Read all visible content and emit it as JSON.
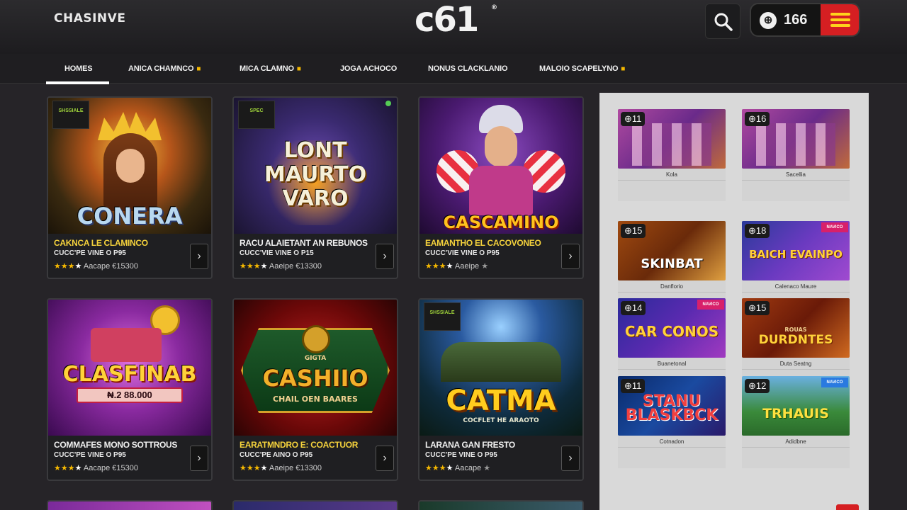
{
  "header": {
    "brand": "CHASINVE",
    "logo": "c61",
    "logo_mark": "®",
    "search_icon": "search-icon",
    "balance": "166",
    "coin_icon": "coin-icon",
    "menu_icon": "hamburger-menu-icon"
  },
  "nav": {
    "items": [
      {
        "label": "HOMES",
        "active": true,
        "badge": false
      },
      {
        "label": "ANICA CHAMNCO",
        "active": false,
        "badge": true
      },
      {
        "label": "MICA CLAMNO",
        "active": false,
        "badge": true
      },
      {
        "label": "JOGA ACHOCO",
        "active": false,
        "badge": false
      },
      {
        "label": "NONUS CLACKLANIO",
        "active": false,
        "badge": false
      },
      {
        "label": "MALOIO SCAPELYNO",
        "active": false,
        "badge": true
      }
    ]
  },
  "cards": [
    {
      "art_title": "CONERA",
      "badge": "SHSSIALE",
      "title": "CAKNCA LE CLAMINCO",
      "sub": "CUCC'PE VINE O P95",
      "rating": 3,
      "meta": "Aacape €15300"
    },
    {
      "art_title": "LONT MAURTO VARO",
      "badge": "SPEC",
      "title": "RACU ALAIETANT AN REBUNOS",
      "sub": "CUCC'VIE VINE O P15",
      "rating": 3,
      "meta": "Aaeipe €13300"
    },
    {
      "art_title": "CASCAMINO",
      "badge": "",
      "title": "EAMANTHO EL CACOVONEO",
      "sub": "CUCC'VIE VINE O P95",
      "rating": 3,
      "meta": "Aaeipe"
    },
    {
      "art_title": "CLASFINAB",
      "art_sub": "₦.2 88.000",
      "badge": "",
      "title": "COMMAFES MONO SOTTROUS",
      "sub": "CUCC'PE VINE O P95",
      "rating": 3,
      "meta": "Aacape €15300"
    },
    {
      "art_title": "CASHIIO",
      "art_sub": "CHAIL OEN BAARES",
      "art_small": "GIGTA",
      "badge": "",
      "title": "EARATMNDRO E: COACTUOR",
      "sub": "CUCC'PE AINO O P95",
      "rating": 3,
      "meta": "Aaeipe €13300"
    },
    {
      "art_title": "CATMA",
      "art_sub": "COCFLET HE ARAOTO",
      "badge": "SHSSIALE",
      "title": "LARANA GAN FRESTO",
      "sub": "CUCC'PE VINE O P95",
      "rating": 3,
      "meta": "Aacape"
    }
  ],
  "side_tiles": [
    {
      "count": "11",
      "art": "",
      "tag": "",
      "caption": "Kola"
    },
    {
      "count": "16",
      "art": "",
      "tag": "",
      "caption": "Sacellia"
    },
    {
      "count": "15",
      "art": "SKINBAT",
      "tag": "",
      "caption": "Danflorio"
    },
    {
      "count": "18",
      "art": "BAICH EVAINPO",
      "tag": "NAVICO",
      "caption": "Calenaco Maure"
    },
    {
      "count": "14",
      "art": "CAR CONOS",
      "tag": "NAVICO",
      "caption": "Buanetonal"
    },
    {
      "count": "15",
      "art": "DURDNTES",
      "art_small": "ROUAS",
      "tag": "",
      "caption": "Duta Seatng"
    },
    {
      "count": "11",
      "art": "STANU BLASKBCK",
      "tag": "",
      "caption": "Cotnadon"
    },
    {
      "count": "12",
      "art": "TRHAUIS",
      "tag": "NAVICO",
      "caption": "Adidbne"
    }
  ],
  "colors": {
    "accent_red": "#d51f22",
    "accent_yellow": "#ffd21c",
    "star": "#f5b800",
    "bg": "#262428",
    "side_panel": "#d9d9d9"
  }
}
